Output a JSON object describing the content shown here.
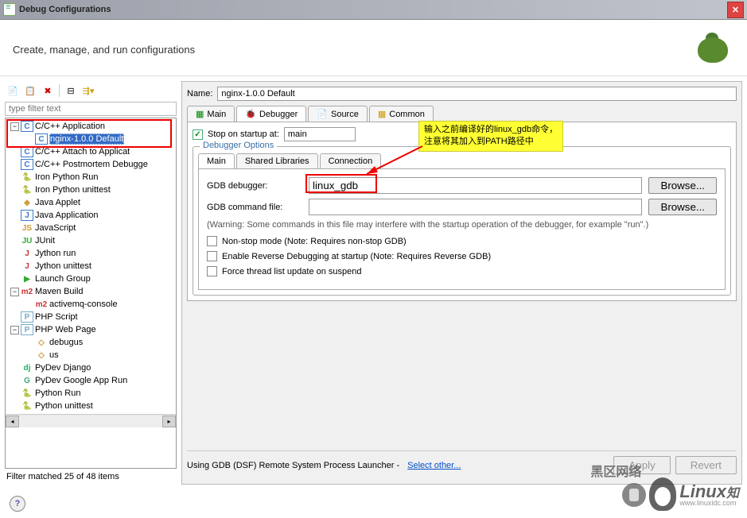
{
  "window": {
    "title": "Debug Configurations"
  },
  "header": {
    "subtitle": "Create, manage, and run configurations"
  },
  "filter": {
    "placeholder": "type filter text",
    "status": "Filter matched 25 of 48 items"
  },
  "tree": {
    "items": [
      {
        "label": "C/C++ Application",
        "icon": "c",
        "expanded": true,
        "children": [
          {
            "label": "nginx-1.0.0 Default",
            "icon": "c",
            "selected": true
          }
        ]
      },
      {
        "label": "C/C++ Attach to Applicat",
        "icon": "c"
      },
      {
        "label": "C/C++ Postmortem Debugge",
        "icon": "c"
      },
      {
        "label": "Iron Python Run",
        "icon": "py-red"
      },
      {
        "label": "Iron Python unittest",
        "icon": "py-red-u"
      },
      {
        "label": "Java Applet",
        "icon": "applet"
      },
      {
        "label": "Java Application",
        "icon": "j"
      },
      {
        "label": "JavaScript",
        "icon": "js"
      },
      {
        "label": "JUnit",
        "icon": "ju"
      },
      {
        "label": "Jython run",
        "icon": "jy"
      },
      {
        "label": "Jython unittest",
        "icon": "jy-u"
      },
      {
        "label": "Launch Group",
        "icon": "launch"
      },
      {
        "label": "Maven Build",
        "icon": "m2",
        "expanded": true,
        "children": [
          {
            "label": "activemq-console",
            "icon": "m2"
          }
        ]
      },
      {
        "label": "PHP Script",
        "icon": "php"
      },
      {
        "label": "PHP Web Page",
        "icon": "php",
        "expanded": true,
        "children": [
          {
            "label": "debugus",
            "icon": "php-web"
          },
          {
            "label": "us",
            "icon": "php-web"
          }
        ]
      },
      {
        "label": "PyDev Django",
        "icon": "dj"
      },
      {
        "label": "PyDev Google App Run",
        "icon": "gapp"
      },
      {
        "label": "Python Run",
        "icon": "py"
      },
      {
        "label": "Python unittest",
        "icon": "py-u"
      }
    ]
  },
  "config": {
    "name_label": "Name:",
    "name_value": "nginx-1.0.0 Default",
    "tabs": [
      {
        "label": "Main"
      },
      {
        "label": "Debugger",
        "active": true
      },
      {
        "label": "Source"
      },
      {
        "label": "Common"
      }
    ],
    "stop_on_startup_label": "Stop on startup at:",
    "stop_on_startup_value": "main",
    "debugger_options_title": "Debugger Options",
    "subtabs": [
      {
        "label": "Main",
        "active": true
      },
      {
        "label": "Shared Libraries"
      },
      {
        "label": "Connection"
      }
    ],
    "gdb_debugger_label": "GDB debugger:",
    "gdb_debugger_value": "linux_gdb",
    "gdb_command_file_label": "GDB command file:",
    "gdb_command_file_value": "",
    "browse_label": "Browse...",
    "warning": "(Warning: Some commands in this file may interfere with the startup operation of the debugger, for example \"run\".)",
    "nonstop_label": "Non-stop mode (Note: Requires non-stop GDB)",
    "reverse_label": "Enable Reverse Debugging at startup (Note: Requires Reverse GDB)",
    "force_thread_label": "Force thread list update on suspend",
    "launcher_text": "Using GDB (DSF) Remote System Process Launcher -",
    "launcher_link": "Select other...",
    "apply_label": "Apply",
    "revert_label": "Revert"
  },
  "annotation": {
    "line1": "输入之前编译好的linux_gdb命令，",
    "line2": "注意将其加入到PATH路径中"
  },
  "watermark": {
    "text1": "黑区网络",
    "text2": "Linux",
    "url": "www.linuxidc.com"
  },
  "icon_map": {
    "c": "C",
    "py-red": "🐍",
    "py-red-u": "🐍",
    "applet": "◈",
    "j": "J",
    "js": "JS",
    "ju": "JU",
    "jy": "J",
    "jy-u": "J",
    "launch": "▶",
    "m2": "m2",
    "php": "P",
    "php-web": "◇",
    "dj": "dj",
    "gapp": "G",
    "py": "🐍",
    "py-u": "🐍"
  }
}
